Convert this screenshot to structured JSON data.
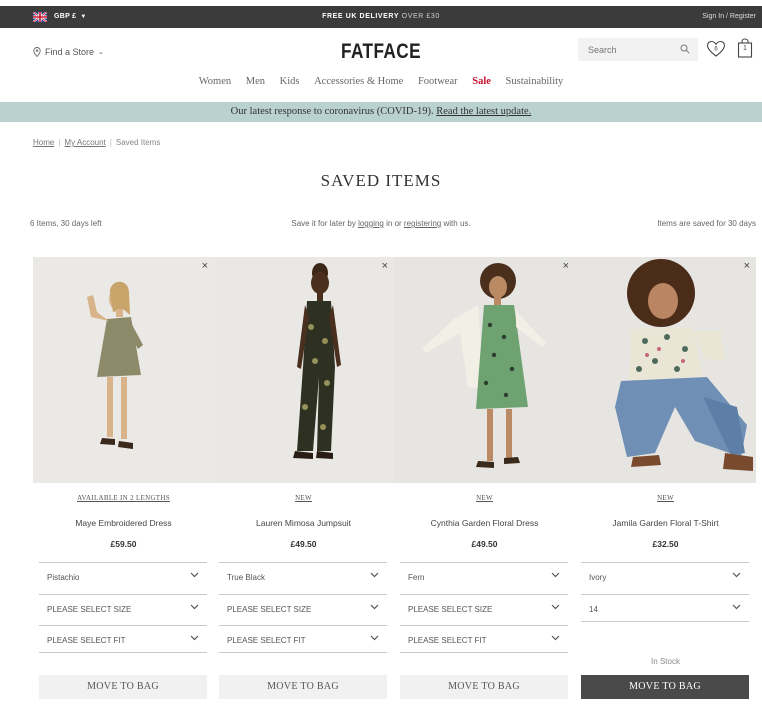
{
  "topbar": {
    "currency": "GBP £",
    "promo_bold": "FREE UK DELIVERY",
    "promo_rest": " OVER £30",
    "signin": "Sign In / Register"
  },
  "header": {
    "store_label": "Find a Store",
    "logo": "FATFACE",
    "search_placeholder": "Search",
    "bag_count": "1"
  },
  "nav": {
    "items": [
      "Women",
      "Men",
      "Kids",
      "Accessories & Home",
      "Footwear",
      "Sale",
      "Sustainability"
    ]
  },
  "covid": {
    "text": "Our latest response to coronavirus (COVID-19). ",
    "link": "Read the latest update."
  },
  "breadcrumb": {
    "home": "Home",
    "account": "My Account",
    "current": "Saved Items"
  },
  "page": {
    "title": "SAVED ITEMS",
    "count_text": "6 Items, 30 days left",
    "save_prefix": "Save it for later by ",
    "logging": "logging",
    "save_mid": " in or ",
    "registering": "registering",
    "save_suffix": " with us.",
    "saved_days": "Items are saved for 30 days"
  },
  "products": [
    {
      "badge": "AVAILABLE IN 2 LENGTHS",
      "name": "Maye Embroidered Dress",
      "price": "£59.50",
      "colour": "Pistachio",
      "size": "PLEASE SELECT SIZE",
      "fit": "PLEASE SELECT FIT",
      "button": "MOVE TO BAG"
    },
    {
      "badge": "NEW",
      "name": "Lauren Mimosa Jumpsuit",
      "price": "£49.50",
      "colour": "True Black",
      "size": "PLEASE SELECT SIZE",
      "fit": "PLEASE SELECT FIT",
      "button": "MOVE TO BAG"
    },
    {
      "badge": "NEW",
      "name": "Cynthia Garden Floral Dress",
      "price": "£49.50",
      "colour": "Fern",
      "size": "PLEASE SELECT SIZE",
      "fit": "PLEASE SELECT FIT",
      "button": "MOVE TO BAG"
    },
    {
      "badge": "NEW",
      "name": "Jamila Garden Floral T-Shirt",
      "price": "£32.50",
      "colour": "Ivory",
      "size": "14",
      "stock": "In Stock",
      "button": "MOVE TO BAG"
    }
  ],
  "icons": {
    "close": "×"
  },
  "colors": {
    "sale": "#c8102e",
    "banner": "#b9d1cf",
    "topbar": "#3b3b3b",
    "button_active": "#4a4a4a"
  }
}
